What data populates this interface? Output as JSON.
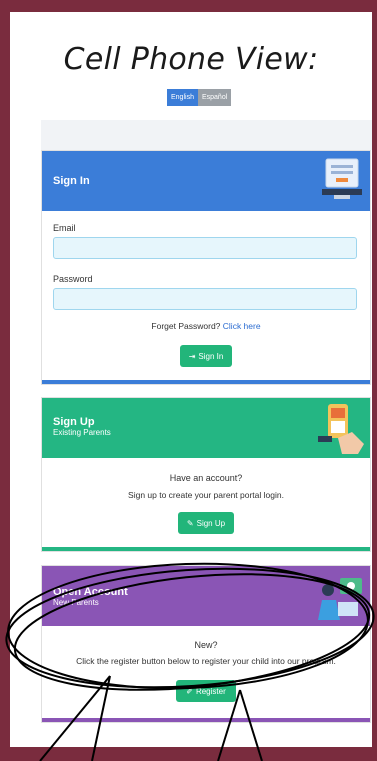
{
  "page": {
    "title": "Cell Phone View:"
  },
  "language": {
    "english": "English",
    "spanish": "Español"
  },
  "signin": {
    "title": "Sign In",
    "email_label": "Email",
    "password_label": "Password",
    "forgot_text": "Forget Password?",
    "forgot_link": "Click here",
    "button_label": "Sign In"
  },
  "signup": {
    "title": "Sign Up",
    "subtitle": "Existing Parents",
    "prompt": "Have an account?",
    "description": "Sign up to create your parent portal login.",
    "button_label": "Sign Up"
  },
  "open_account": {
    "title": "Open Account",
    "subtitle": "New Parents",
    "prompt": "New?",
    "description": "Click the register button below to register your child into our program.",
    "button_label": "Register"
  },
  "colors": {
    "background": "#7a2c3e",
    "signin_header": "#3b7dd8",
    "signup_header": "#24b683",
    "open_header": "#8a55b5",
    "button": "#22b57a"
  }
}
